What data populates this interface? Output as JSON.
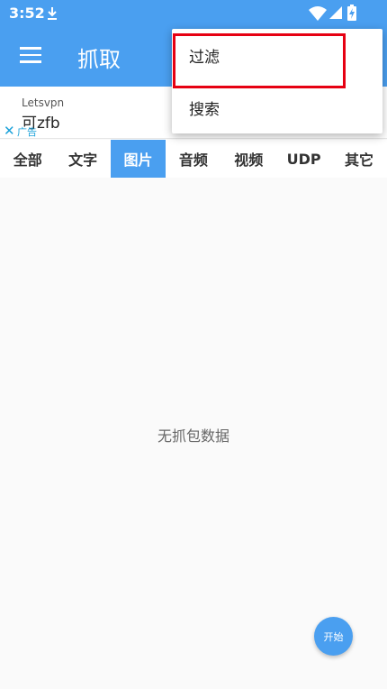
{
  "status": {
    "time": "3:52"
  },
  "appbar": {
    "title": "抓取"
  },
  "ad": {
    "brand": "Letsvpn",
    "text": "可zfb",
    "close_glyph": "✕",
    "label": "广告"
  },
  "tabs": [
    {
      "label": "全部"
    },
    {
      "label": "文字"
    },
    {
      "label": "图片"
    },
    {
      "label": "音频"
    },
    {
      "label": "视频"
    },
    {
      "label": "UDP"
    },
    {
      "label": "其它"
    }
  ],
  "active_tab": "图片",
  "empty_text": "无抓包数据",
  "fab": {
    "label": "开始"
  },
  "menu": {
    "items": [
      {
        "label": "过滤"
      },
      {
        "label": "搜索"
      }
    ]
  },
  "colors": {
    "primary": "#4a9ff0",
    "highlight": "#e60012"
  }
}
